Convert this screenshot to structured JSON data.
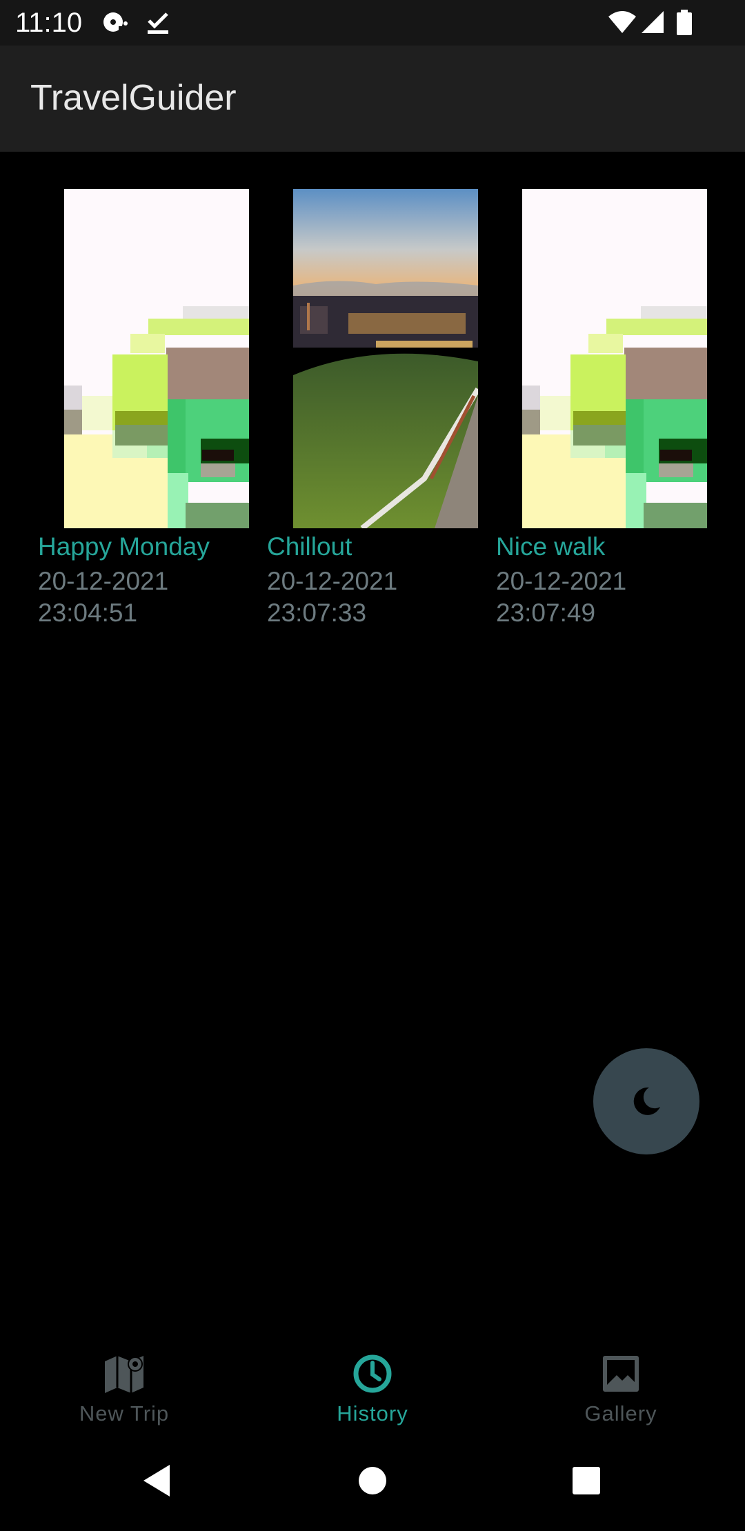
{
  "status_bar": {
    "time": "11:10",
    "icons": [
      "media-icon",
      "download-done-icon",
      "wifi-icon",
      "signal-icon",
      "battery-icon"
    ]
  },
  "app_bar": {
    "title": "TravelGuider"
  },
  "trips": [
    {
      "title": "Happy Monday",
      "date": "20-12-2021",
      "time": "23:04:51",
      "thumbnail": "pixelated-image"
    },
    {
      "title": "Chillout",
      "date": "20-12-2021",
      "time": "23:07:33",
      "thumbnail": "city-sunset-photo"
    },
    {
      "title": "Nice walk",
      "date": "20-12-2021",
      "time": "23:07:49",
      "thumbnail": "pixelated-image"
    }
  ],
  "fab": {
    "icon": "moon-icon"
  },
  "bottom_nav": {
    "items": [
      {
        "label": "New Trip",
        "icon": "map-icon",
        "active": false
      },
      {
        "label": "History",
        "icon": "history-icon",
        "active": true
      },
      {
        "label": "Gallery",
        "icon": "gallery-icon",
        "active": false
      }
    ]
  },
  "colors": {
    "accent": "#26a69a",
    "subtitle": "#6d7b80",
    "nav_inactive": "#4e5659",
    "fab_bg": "#37474f",
    "app_bar_bg": "#1f1f1f"
  }
}
